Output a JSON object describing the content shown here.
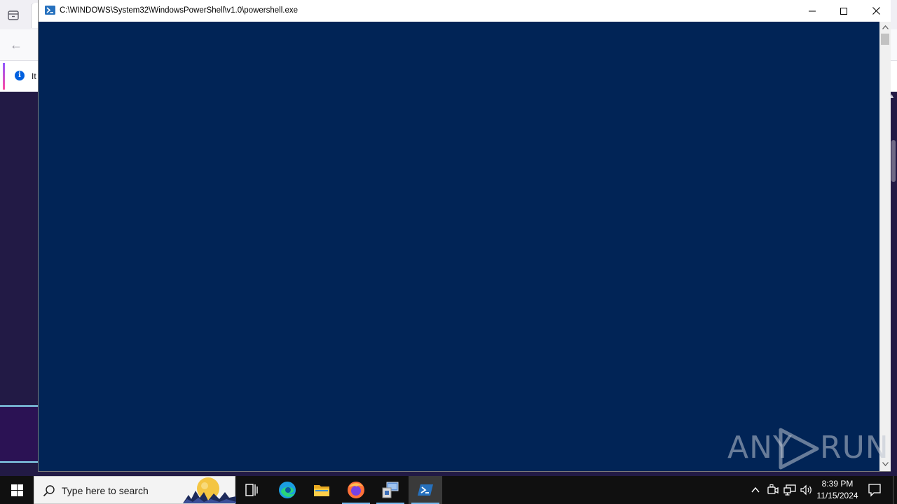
{
  "background_browser": {
    "info_bar_text": "It"
  },
  "powershell": {
    "title": "C:\\WINDOWS\\System32\\WindowsPowerShell\\v1.0\\powershell.exe",
    "console_bg": "#012456"
  },
  "watermark": {
    "left_text": "ANY",
    "right_text": "RUN"
  },
  "taskbar": {
    "search_placeholder": "Type here to search",
    "apps": [
      "task-view",
      "microsoft-edge",
      "file-explorer",
      "firefox",
      "installer",
      "windows-powershell"
    ],
    "active_app": "windows-powershell",
    "clock": {
      "time": "8:39 PM",
      "date": "11/15/2024"
    }
  }
}
